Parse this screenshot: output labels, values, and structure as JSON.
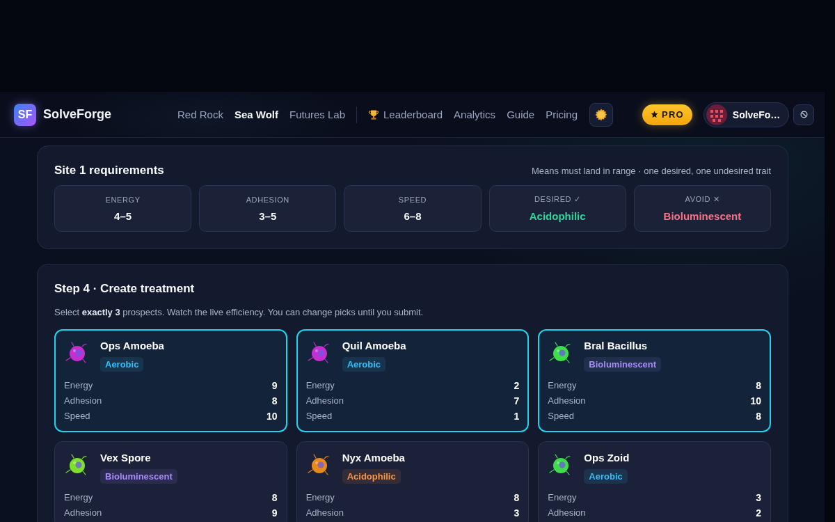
{
  "header": {
    "brand": {
      "logo": "SF",
      "name": "SolveForge"
    },
    "sites": [
      {
        "label": "Red Rock",
        "selected": false
      },
      {
        "label": "Sea Wolf",
        "selected": true
      },
      {
        "label": "Futures Lab",
        "selected": false
      }
    ],
    "links": [
      {
        "label": "Leaderboard",
        "kind": "featured",
        "selected": false
      },
      {
        "label": "Analytics",
        "kind": "plain",
        "selected": false
      },
      {
        "label": "Guide",
        "kind": "plain",
        "selected": false
      },
      {
        "label": "Pricing",
        "kind": "plain",
        "selected": false
      }
    ],
    "pro_badge": {
      "label": "PRO"
    },
    "user": {
      "name": "SolveFo…"
    }
  },
  "requirements": {
    "title": "Site 1 requirements",
    "note": "Means must land in range · one desired, one undesired trait",
    "items": [
      {
        "kind": "range",
        "label": "ENERGY",
        "value": "4–5"
      },
      {
        "kind": "range",
        "label": "ADHESION",
        "value": "3–5"
      },
      {
        "kind": "range",
        "label": "SPEED",
        "value": "6–8"
      },
      {
        "kind": "desired",
        "label": "DESIRED ✓",
        "value": "Acidophilic"
      },
      {
        "kind": "avoid",
        "label": "AVOID ✕",
        "value": "Bioluminescent"
      }
    ]
  },
  "treatment": {
    "title": "Step 4 · Create treatment",
    "instructions": "Select **exactly 3** prospects. Watch the live efficiency. You can change picks until you submit.",
    "prospects": [
      {
        "name": "Ops Amoeba",
        "color": "#c42fd0",
        "selected": true,
        "tag": {
          "label": "Aerobic",
          "color": "#38bdf8"
        },
        "stats": [
          {
            "label": "Energy",
            "value": "9"
          },
          {
            "label": "Adhesion",
            "value": "8"
          },
          {
            "label": "Speed",
            "value": "10"
          }
        ]
      },
      {
        "name": "Quil Amoeba",
        "color": "#c42fd0",
        "selected": true,
        "tag": {
          "label": "Aerobic",
          "color": "#38bdf8"
        },
        "stats": [
          {
            "label": "Energy",
            "value": "2"
          },
          {
            "label": "Adhesion",
            "value": "7"
          },
          {
            "label": "Speed",
            "value": "1"
          }
        ]
      },
      {
        "name": "Bral Bacillus",
        "color": "#3fdc4c",
        "selected": true,
        "tag": {
          "label": "Bioluminescent",
          "color": "#a78bfa"
        },
        "stats": [
          {
            "label": "Energy",
            "value": "8"
          },
          {
            "label": "Adhesion",
            "value": "10"
          },
          {
            "label": "Speed",
            "value": "8"
          }
        ]
      },
      {
        "name": "Vex Spore",
        "color": "#7ee02c",
        "selected": false,
        "tag": {
          "label": "Bioluminescent",
          "color": "#a78bfa"
        },
        "stats": [
          {
            "label": "Energy",
            "value": "8"
          },
          {
            "label": "Adhesion",
            "value": "9"
          }
        ]
      },
      {
        "name": "Nyx Amoeba",
        "color": "#e8891c",
        "selected": false,
        "tag": {
          "label": "Acidophilic",
          "color": "#f7954a"
        },
        "stats": [
          {
            "label": "Energy",
            "value": "8"
          },
          {
            "label": "Adhesion",
            "value": "3"
          }
        ]
      },
      {
        "name": "Ops Zoid",
        "color": "#3fdc4c",
        "selected": false,
        "tag": {
          "label": "Aerobic",
          "color": "#38bdf8"
        },
        "stats": [
          {
            "label": "Energy",
            "value": "3"
          },
          {
            "label": "Adhesion",
            "value": "2"
          }
        ]
      }
    ]
  }
}
